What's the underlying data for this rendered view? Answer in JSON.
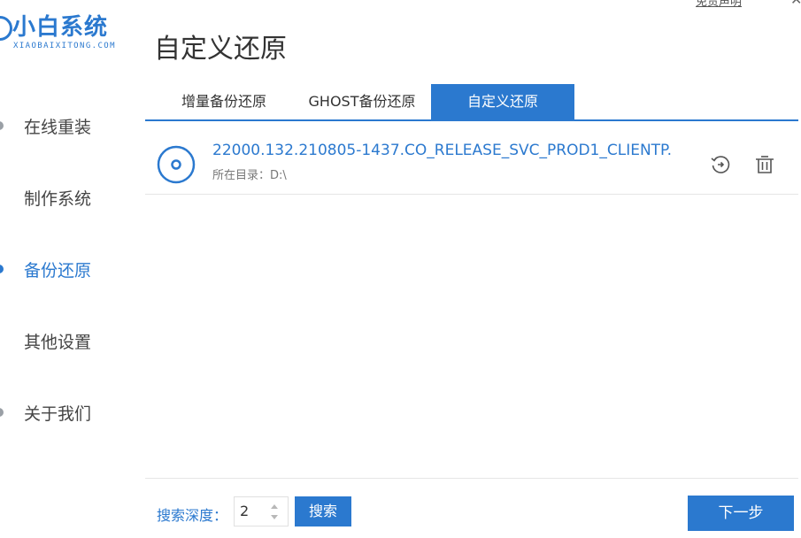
{
  "brand": {
    "name": "小白系统",
    "subtitle": "XIAOBAIXITONG.COM",
    "color": "#2b79cf"
  },
  "window": {
    "top_link": "免责声明",
    "minimize_icon": "minimize-icon",
    "close_icon": "close-icon"
  },
  "sidebar": {
    "items": [
      {
        "label": "在线重装",
        "active": false
      },
      {
        "label": "制作系统",
        "active": false
      },
      {
        "label": "备份还原",
        "active": true
      },
      {
        "label": "其他设置",
        "active": false
      },
      {
        "label": "关于我们",
        "active": false
      }
    ]
  },
  "page": {
    "title": "自定义还原"
  },
  "tabs": [
    {
      "label": "增量备份还原",
      "active": false
    },
    {
      "label": "GHOST备份还原",
      "active": false
    },
    {
      "label": "自定义还原",
      "active": true
    }
  ],
  "list": {
    "items": [
      {
        "icon": "disc-icon",
        "title": "22000.132.210805-1437.CO_RELEASE_SVC_PROD1_CLIENTP...",
        "location_label": "所在目录：",
        "location_value": "D:\\",
        "actions": [
          "restore-icon",
          "delete-icon"
        ]
      }
    ]
  },
  "footer": {
    "depth_label": "搜索深度：",
    "depth_value": "2",
    "search_label": "搜索",
    "next_label": "下一步"
  },
  "colors": {
    "accent": "#2b79cf",
    "text": "#333333",
    "muted": "#777777",
    "divider": "#e6e6e6"
  }
}
